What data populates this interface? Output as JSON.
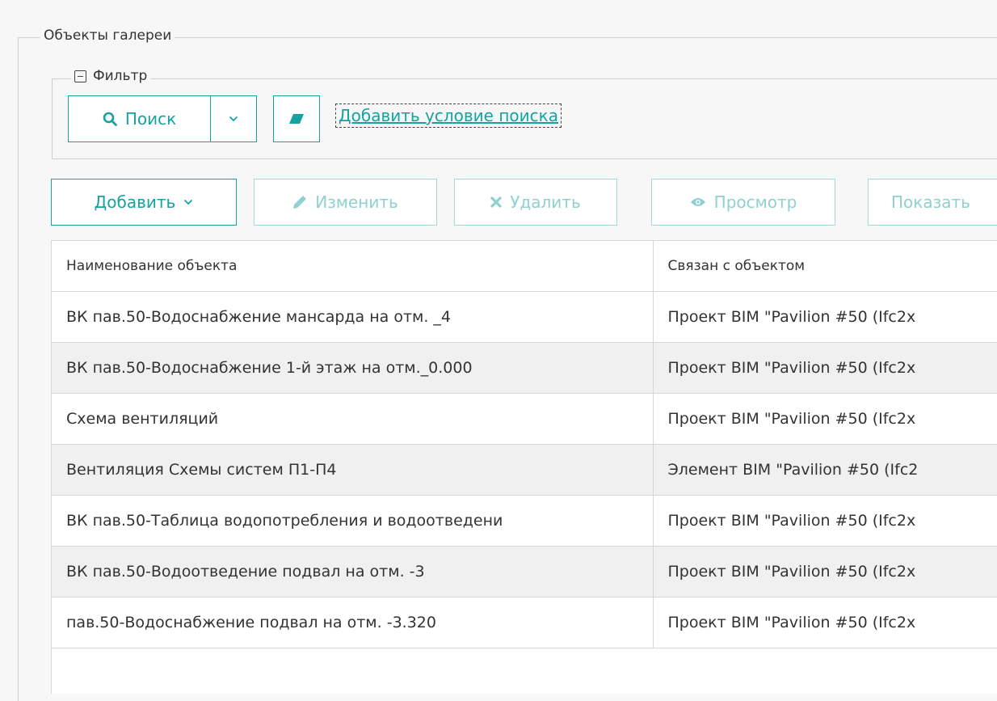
{
  "gallery": {
    "legend": "Объекты галереи"
  },
  "filter": {
    "legend": "Фильтр",
    "search_label": "Поиск",
    "add_condition_label": "Добавить условие поиска"
  },
  "toolbar": {
    "add_label": "Добавить",
    "edit_label": "Изменить",
    "delete_label": "Удалить",
    "view_label": "Просмотр",
    "show_label": "Показать"
  },
  "table": {
    "columns": [
      "Наименование объекта",
      "Связан с объектом"
    ],
    "rows": [
      [
        "ВК пав.50-Водоснабжение мансарда на отм. _4",
        "Проект BIM \"Pavilion #50 (Ifc2x"
      ],
      [
        "ВК пав.50-Водоснабжение 1-й этаж на отм._0.000",
        "Проект BIM \"Pavilion #50 (Ifc2x"
      ],
      [
        "Схема вентиляций",
        "Проект BIM \"Pavilion #50 (Ifc2x"
      ],
      [
        "Вентиляция Схемы систем П1-П4",
        "Элемент BIM \"Pavilion #50 (Ifc2"
      ],
      [
        "ВК пав.50-Таблица водопотребления и водоотведени",
        "Проект BIM \"Pavilion #50 (Ifc2x"
      ],
      [
        "ВК пав.50-Водоотведение подвал на отм. -3",
        "Проект BIM \"Pavilion #50 (Ifc2x"
      ],
      [
        "пав.50-Водоснабжение подвал на отм. -3.320",
        "Проект BIM \"Pavilion #50 (Ifc2x"
      ]
    ]
  },
  "colors": {
    "accent": "#17a2a2",
    "accent_disabled": "#8fd0d0",
    "row_alt": "#f0f0f0",
    "border": "#d6d6d6"
  },
  "icons": {
    "search": "search-icon",
    "caret": "chevron-down-icon",
    "eraser": "eraser-icon",
    "edit": "pencil-icon",
    "delete": "close-icon",
    "view": "eye-icon",
    "collapse": "collapse-minus-icon"
  }
}
